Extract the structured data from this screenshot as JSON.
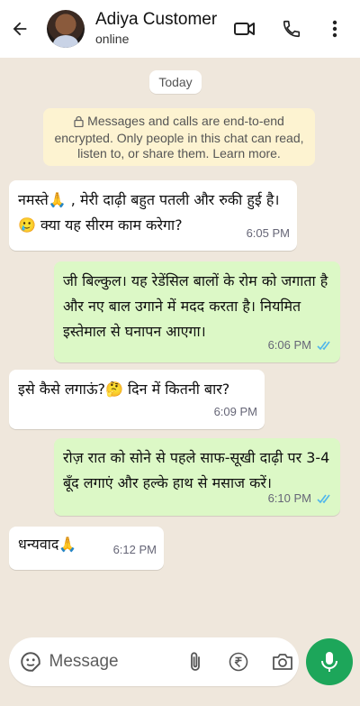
{
  "header": {
    "contact_name": "Adiya Customer",
    "status": "online",
    "icons": [
      "back-arrow-icon",
      "video-call-icon",
      "phone-icon",
      "more-vert-icon"
    ]
  },
  "chat": {
    "date_label": "Today",
    "encryption_notice": "Messages and calls are end-to-end encrypted. Only people in this chat can read, listen to, or share them. Learn more.",
    "messages": [
      {
        "direction": "incoming",
        "text": "नमस्ते🙏 , मेरी दाढ़ी बहुत पतली और रुकी हुई है।🥲 क्या यह सीरम काम करेगा?",
        "time": "6:05 PM"
      },
      {
        "direction": "outgoing",
        "text": "जी बिल्कुल। यह रेडेंसिल बालों के रोम को जगाता है और नए बाल उगाने में मदद करता है। नियमित इस्तेमाल से घनापन आएगा।",
        "time": "6:06 PM",
        "read": true
      },
      {
        "direction": "incoming",
        "text": "इसे कैसे लगाऊं?🤔 दिन में कितनी बार?",
        "time": "6:09 PM"
      },
      {
        "direction": "outgoing",
        "text": "रोज़ रात को सोने से पहले साफ-सूखी दाढ़ी पर 3-4 बूँद लगाएं और हल्के हाथ से मसाज करें।",
        "time": "6:10 PM",
        "read": true
      },
      {
        "direction": "incoming",
        "text": "धन्यवाद🙏",
        "time": "6:12 PM"
      }
    ]
  },
  "composer": {
    "placeholder": "Message",
    "icons": [
      "sticker-icon",
      "attach-icon",
      "rupee-payment-icon",
      "camera-icon",
      "mic-icon"
    ]
  },
  "colors": {
    "accent": "#1da65a",
    "outgoing_bubble": "#dcf8c6",
    "incoming_bubble": "#ffffff",
    "chat_background": "#efe7dc",
    "read_ticks": "#4fb6ec"
  }
}
